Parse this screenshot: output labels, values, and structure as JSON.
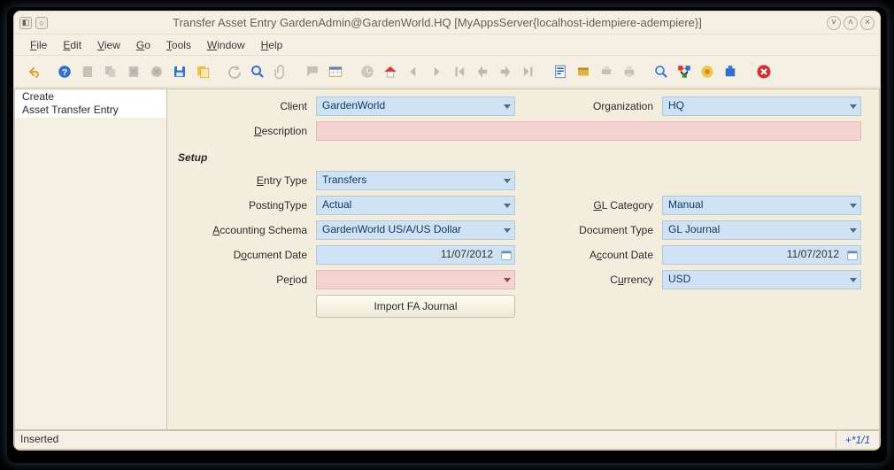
{
  "titlebar": {
    "title": "Transfer Asset Entry  GardenAdmin@GardenWorld.HQ [MyAppsServer{localhost-idempiere-adempiere}]"
  },
  "menubar": {
    "file": {
      "label": "File",
      "u": "F"
    },
    "edit": {
      "label": "Edit",
      "u": "E"
    },
    "view": {
      "label": "View",
      "u": "V"
    },
    "go": {
      "label": "Go",
      "u": "G"
    },
    "tools": {
      "label": "Tools",
      "u": "T"
    },
    "window": {
      "label": "Window",
      "u": "W"
    },
    "help": {
      "label": "Help",
      "u": "H"
    }
  },
  "sidebar": {
    "items": [
      {
        "label": "Create"
      },
      {
        "label": "Asset Transfer Entry"
      }
    ],
    "L0": "Create",
    "L1": "Asset Transfer Entry"
  },
  "form": {
    "labels": {
      "client": "Client",
      "organization": "Organization",
      "description": "Description",
      "setup": "Setup",
      "entryType": "Entry Type",
      "postingType": "PostingType",
      "glCategory": "GL Category",
      "accountingSchema": "Accounting Schema",
      "documentType": "Document Type",
      "documentDate": "Document Date",
      "accountDate": "Account Date",
      "period": "Period",
      "currency": "Currency",
      "importBtn": "Import FA Journal"
    },
    "values": {
      "client": "GardenWorld",
      "organization": "HQ",
      "description": "",
      "entryType": "Transfers",
      "postingType": "Actual",
      "glCategory": "Manual",
      "accountingSchema": "GardenWorld US/A/US Dollar",
      "documentType": "GL Journal",
      "documentDate": "11/07/2012",
      "accountDate": "11/07/2012",
      "period": "",
      "currency": "USD"
    }
  },
  "status": {
    "text": "Inserted",
    "nav": "+*1/1"
  }
}
